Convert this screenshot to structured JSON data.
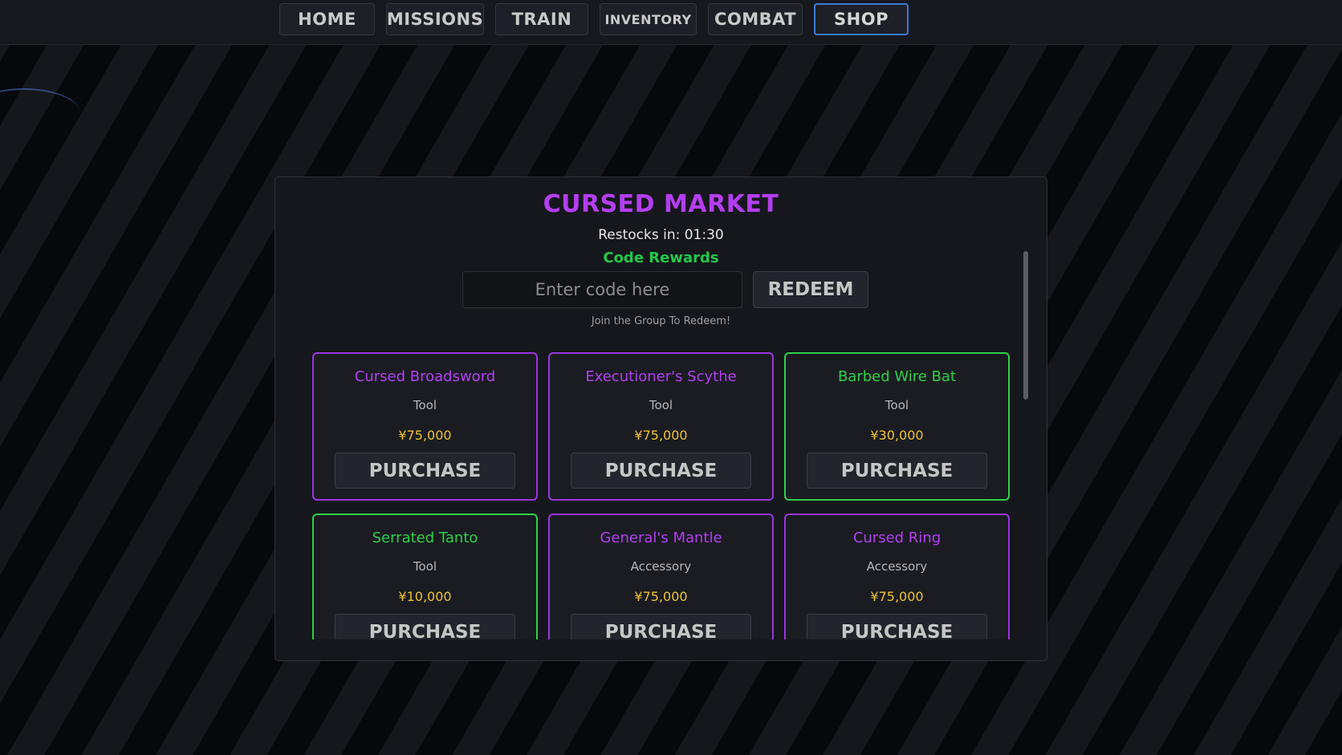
{
  "nav": {
    "items": [
      {
        "label": "HOME"
      },
      {
        "label": "MISSIONS"
      },
      {
        "label": "TRAIN"
      },
      {
        "label": "INVENTORY"
      },
      {
        "label": "COMBAT"
      },
      {
        "label": "SHOP"
      }
    ],
    "active": "SHOP"
  },
  "shop": {
    "title": "CURSED MARKET",
    "restock": "Restocks in: 01:30",
    "code_rewards": "Code Rewards",
    "code_input": {
      "placeholder": "Enter code here",
      "value": ""
    },
    "redeem_label": "REDEEM",
    "join_note": "Join the Group To Redeem!",
    "items": [
      {
        "name": "Cursed Broadsword",
        "type": "Tool",
        "price": "¥75,000",
        "purchase_label": "PURCHASE",
        "color": "#b43ef2"
      },
      {
        "name": "Executioner's Scythe",
        "type": "Tool",
        "price": "¥75,000",
        "purchase_label": "PURCHASE",
        "color": "#b43ef2"
      },
      {
        "name": "Barbed Wire Bat",
        "type": "Tool",
        "price": "¥30,000",
        "purchase_label": "PURCHASE",
        "color": "#2fd04a"
      },
      {
        "name": "Serrated Tanto",
        "type": "Tool",
        "price": "¥10,000",
        "purchase_label": "PURCHASE",
        "color": "#2fd04a"
      },
      {
        "name": "General's Mantle",
        "type": "Accessory",
        "price": "¥75,000",
        "purchase_label": "PURCHASE",
        "color": "#b43ef2"
      },
      {
        "name": "Cursed Ring",
        "type": "Accessory",
        "price": "¥75,000",
        "purchase_label": "PURCHASE",
        "color": "#b43ef2"
      }
    ]
  },
  "colors": {
    "accent_purple": "#b43ef2",
    "accent_green": "#2fd04a",
    "price_gold": "#eec22d",
    "active_tab_border": "#3a7bd5"
  }
}
